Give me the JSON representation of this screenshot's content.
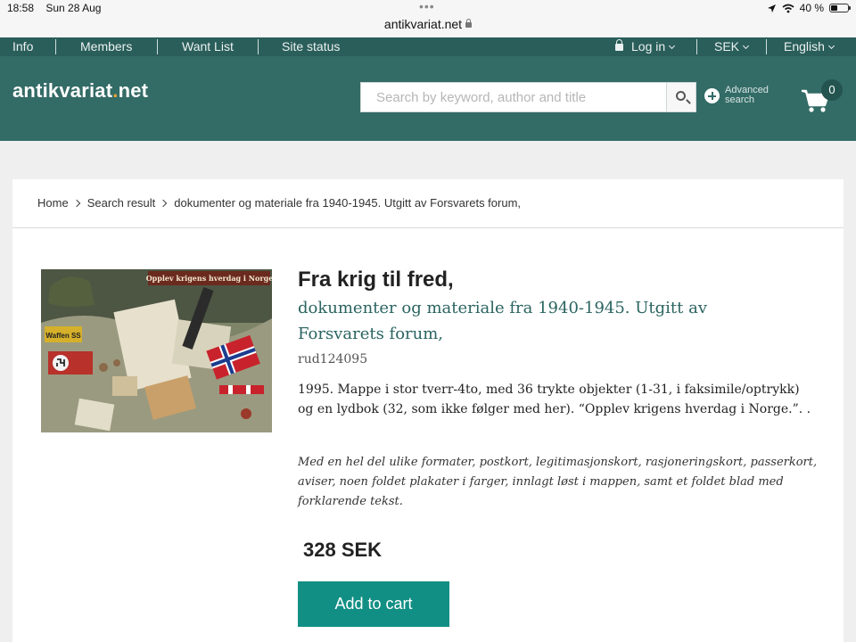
{
  "status_bar": {
    "time": "18:58",
    "date": "Sun 28 Aug",
    "url": "antikvariat.net",
    "battery": "40 %",
    "battery_level": 0.4
  },
  "top_nav": {
    "left_items": [
      "Info",
      "Members",
      "Want List",
      "Site status"
    ],
    "login": "Log in",
    "currency": "SEK",
    "language": "English"
  },
  "header": {
    "logo_main": "antikvariat",
    "logo_dot": ".",
    "logo_tld": "net",
    "search_placeholder": "Search by keyword, author and title",
    "advanced_search": "Advanced search",
    "cart_count": "0"
  },
  "breadcrumb": [
    "Home",
    "Search result",
    "dokumenter og materiale fra 1940-1945. Utgitt av Forsvarets forum,"
  ],
  "product": {
    "image_caption": "Opplev krigens hverdag i Norge",
    "image_sign": "Waffen SS",
    "title": "Fra krig til fred,",
    "subtitle": "dokumenter og materiale fra 1940-1945. Utgitt av Forsvarets forum,",
    "ref": "rud124095",
    "description": "1995. Mappe i stor tverr-4to, med 36 trykte objekter (1-31, i faksimile/optrykk) og en lydbok (32, som ikke følger med her). “Opplev krigens hverdag i Norge.”. .",
    "note": "Med en hel del ulike formater, postkort, legitimasjonskort, rasjoneringskort, passerkort, aviser, noen foldet plakater i farger, innlagt løst i mappen, samt et foldet blad med forklarende tekst.",
    "price": "328 SEK",
    "add_to_cart": "Add to cart"
  },
  "colors": {
    "nav_bg": "#2a5e5a",
    "header_bg": "#336b66",
    "accent_button": "#128f84",
    "subtitle_text": "#2a6460",
    "logo_dot": "#e8a33a"
  }
}
